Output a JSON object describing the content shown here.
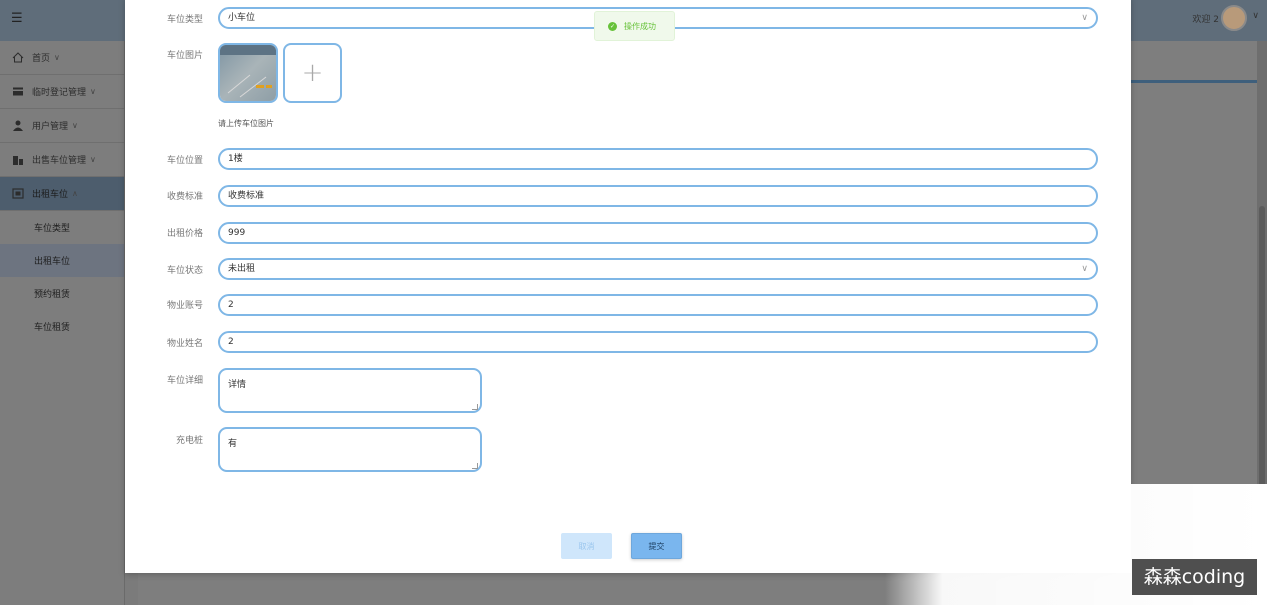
{
  "header": {
    "welcome": "欢迎 2"
  },
  "sidebar": {
    "items": [
      {
        "label": "首页",
        "icon": "home-icon",
        "caret": "∨"
      },
      {
        "label": "临时登记管理",
        "icon": "card-icon",
        "caret": "∨"
      },
      {
        "label": "用户管理",
        "icon": "user-icon",
        "caret": "∨"
      },
      {
        "label": "出售车位管理",
        "icon": "building-icon",
        "caret": "∨"
      },
      {
        "label": "出租车位",
        "icon": "grid-icon",
        "caret": "∧"
      }
    ],
    "subitems": [
      {
        "label": "车位类型",
        "active": false
      },
      {
        "label": "出租车位",
        "active": true
      },
      {
        "label": "预约租赁",
        "active": false
      },
      {
        "label": "车位租赁",
        "active": false
      }
    ]
  },
  "form": {
    "type": {
      "label": "车位类型",
      "value": "小车位"
    },
    "image": {
      "label": "车位图片",
      "hint": "请上传车位图片"
    },
    "location": {
      "label": "车位位置",
      "value": "1楼"
    },
    "fee": {
      "label": "收费标准",
      "value": "收费标准"
    },
    "price": {
      "label": "出租价格",
      "value": "999"
    },
    "status": {
      "label": "车位状态",
      "value": "未出租"
    },
    "account": {
      "label": "物业账号",
      "value": "2"
    },
    "name": {
      "label": "物业姓名",
      "value": "2"
    },
    "detail": {
      "label": "车位详细",
      "value": "详情"
    },
    "charger": {
      "label": "充电桩",
      "value": "有"
    }
  },
  "buttons": {
    "cancel": "取消",
    "submit": "提交"
  },
  "toast": {
    "message": "操作成功"
  },
  "watermark": "森森coding",
  "colors": {
    "accent": "#7fb7e6",
    "primary_button": "#7ab6ee",
    "success": "#67c23a"
  }
}
